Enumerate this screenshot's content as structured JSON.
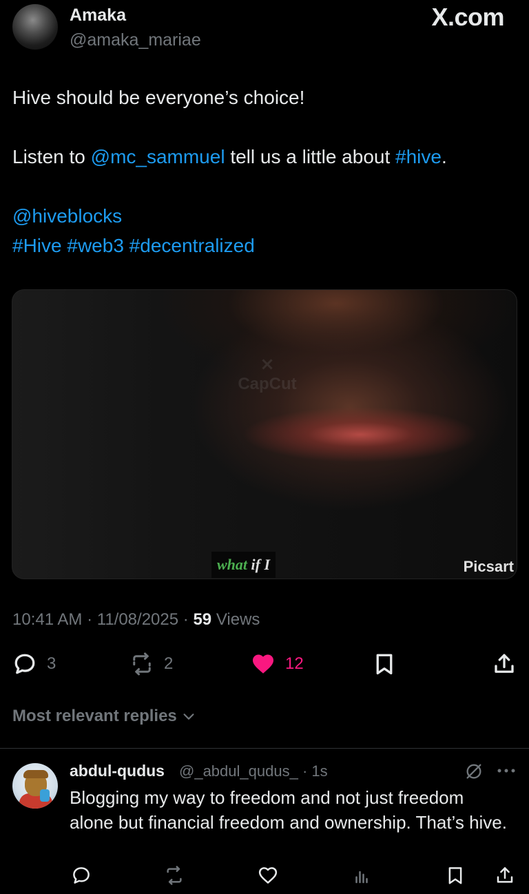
{
  "author": {
    "name": "Amaka",
    "handle": "@amaka_mariae"
  },
  "brand": "X.com",
  "tweet": {
    "line1": "Hive should be everyone’s choice!",
    "line2_prefix": "Listen to ",
    "line2_mention": "@mc_sammuel",
    "line2_middle": " tell us a little about ",
    "line2_hashtag": "#hive",
    "line2_suffix": ".",
    "mention_line": "@hiveblocks",
    "hashtag_1": "#Hive",
    "hashtag_2": "#web3",
    "hashtag_3": "#decentralized"
  },
  "media": {
    "watermark": "CapCut",
    "caption_what": "what",
    "caption_rest": " if I",
    "corner_watermark": "Picsart"
  },
  "meta": {
    "time": "10:41 AM",
    "date": "11/08/2025",
    "separator": "·",
    "views_count": "59",
    "views_label": "Views"
  },
  "actions": {
    "replies": "3",
    "reposts": "2",
    "likes": "12"
  },
  "replies_filter": {
    "label": "Most relevant replies"
  },
  "reply": {
    "name": "abdul-qudus",
    "handle": "@_abdul_qudus_",
    "time": "· 1s",
    "text": "Blogging my way to freedom and not just freedom alone but financial freedom and ownership. That’s hive."
  },
  "colors": {
    "background": "#000000",
    "text": "#e7e9ea",
    "secondary": "#71767b",
    "link": "#1d9bf0",
    "like": "#f91880"
  }
}
